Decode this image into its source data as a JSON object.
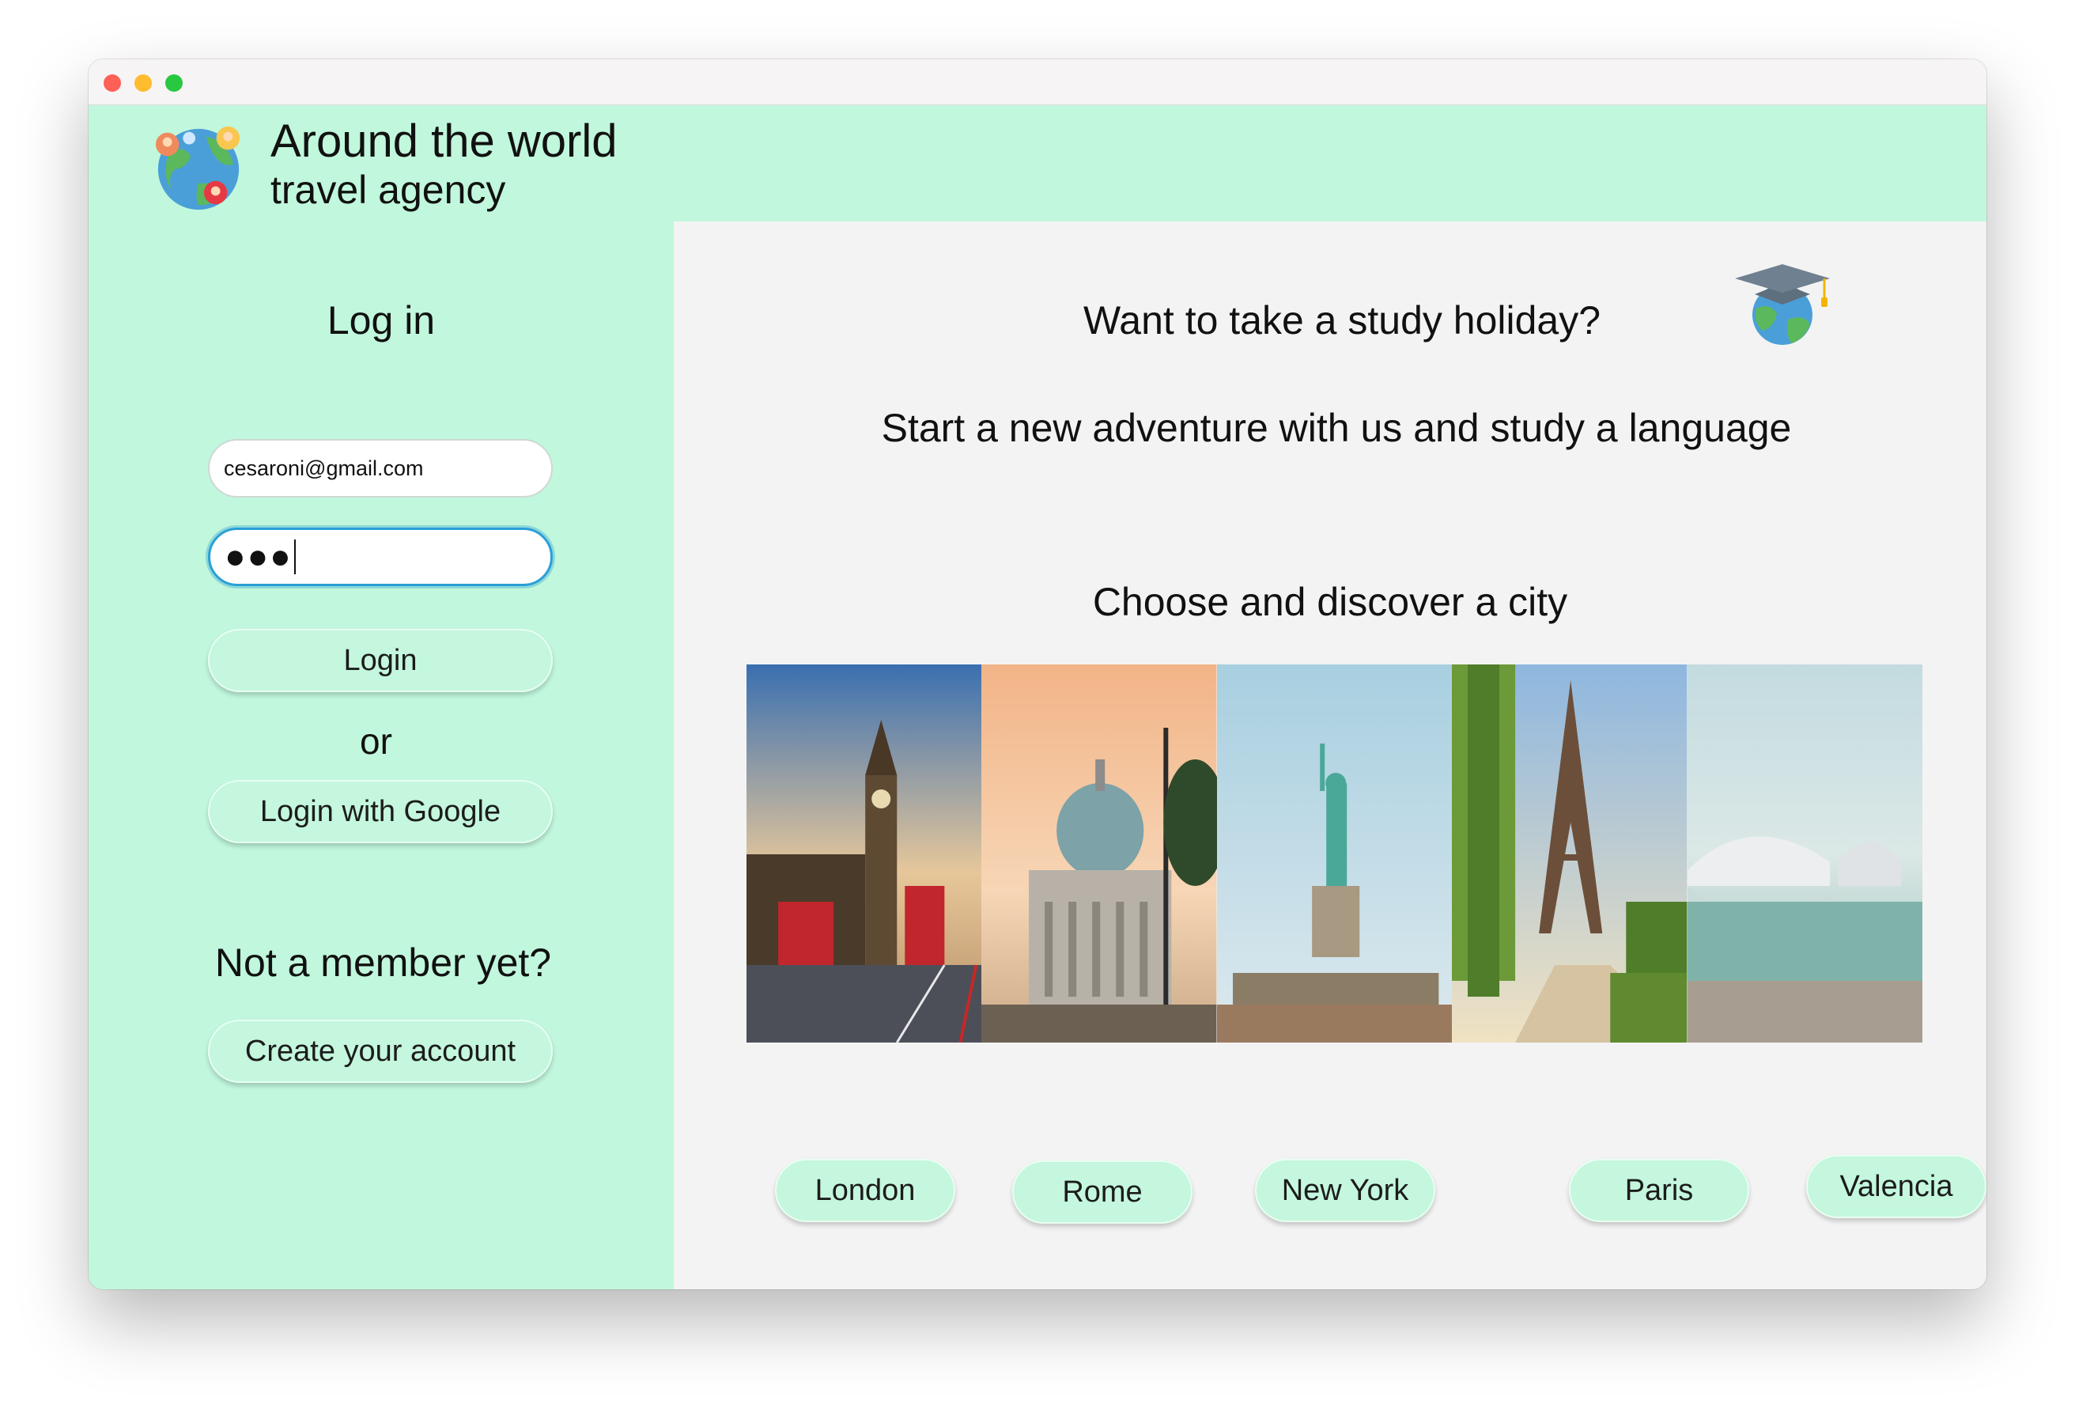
{
  "window": {
    "controls": [
      "close",
      "minimize",
      "zoom"
    ]
  },
  "brand": {
    "title": "Around the world",
    "subtitle": "travel agency",
    "logo_icon": "globe-people-icon"
  },
  "login": {
    "heading": "Log in",
    "email_value": "cesaroni@gmail.com",
    "password_masked": "●●●",
    "login_label": "Login",
    "or_text": "or",
    "google_label": "Login with Google",
    "member_prompt": "Not a member yet?",
    "create_label": "Create your account"
  },
  "promo": {
    "question": "Want to take a study holiday?",
    "question_icon": "graduation-cap-globe-icon",
    "subtitle": "Start a new adventure with us and study a language",
    "choose_title": "Choose and discover a city"
  },
  "cities": [
    {
      "name": "London",
      "photo": "big-ben-photo"
    },
    {
      "name": "Rome",
      "photo": "st-peters-basilica-photo"
    },
    {
      "name": "New York",
      "photo": "statue-of-liberty-photo"
    },
    {
      "name": "Paris",
      "photo": "eiffel-tower-photo"
    },
    {
      "name": "Valencia",
      "photo": "city-of-arts-and-sciences-photo"
    }
  ],
  "colors": {
    "mint": "#c1f7dc",
    "panel": "#f3f3f3",
    "focus": "#2a9fd6"
  }
}
